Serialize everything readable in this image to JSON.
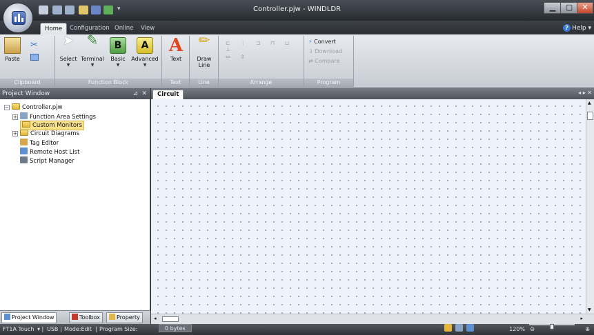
{
  "window": {
    "title": "Controller.pjw - WINDLDR",
    "minimize": "▁",
    "maximize": "▢",
    "close": "✕"
  },
  "tabs": [
    "Home",
    "Configuration",
    "Online",
    "View"
  ],
  "help": "Help",
  "ribbon": {
    "clipboard": {
      "label": "Clipboard",
      "paste": "Paste"
    },
    "function_block": {
      "label": "Function Block",
      "select": "Select",
      "terminal": "Terminal",
      "basic": "Basic",
      "advanced": "Advanced"
    },
    "text": {
      "label": "Text",
      "text": "Text"
    },
    "line": {
      "label": "Line",
      "draw_line": "Draw Line"
    },
    "arrange": {
      "label": "Arrange"
    },
    "program": {
      "label": "Program",
      "convert": "Convert",
      "download": "Download",
      "compare": "Compare"
    }
  },
  "project_window": {
    "title": "Project Window",
    "tree": {
      "root": "Controller.pjw",
      "function_area": "Function Area Settings",
      "custom_monitors": "Custom Monitors",
      "circuit_diagrams": "Circuit Diagrams",
      "tag_editor": "Tag Editor",
      "remote_host": "Remote Host List",
      "script_manager": "Script Manager"
    },
    "tabs": [
      "Project Window",
      "Toolbox",
      "Property"
    ]
  },
  "circuit": {
    "tab": "Circuit"
  },
  "status": {
    "plc": "FT1A Touch",
    "port": "USB",
    "mode": "Mode:Edit",
    "program_size": "Program Size:",
    "bytes": "0 bytes",
    "zoom": "120%"
  },
  "colors": {
    "dark_chrome": "#2b2d33",
    "ribbon": "#dfe3e8",
    "grid_bg": "#eef2fa",
    "selection": "#f9e28e"
  }
}
